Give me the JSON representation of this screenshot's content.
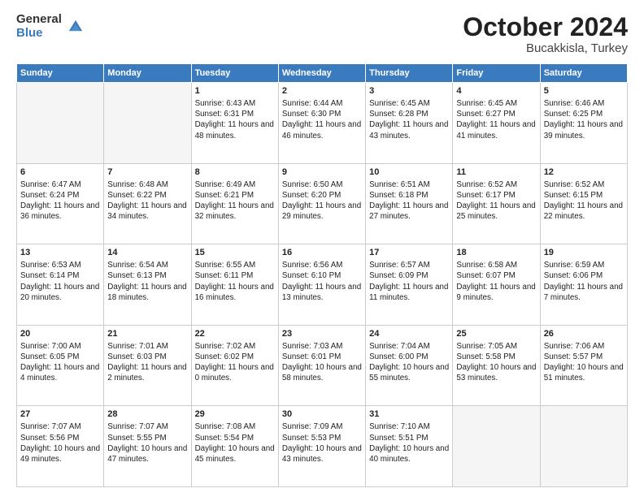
{
  "logo": {
    "general": "General",
    "blue": "Blue"
  },
  "header": {
    "month": "October 2024",
    "location": "Bucakkisla, Turkey"
  },
  "weekdays": [
    "Sunday",
    "Monday",
    "Tuesday",
    "Wednesday",
    "Thursday",
    "Friday",
    "Saturday"
  ],
  "weeks": [
    [
      {
        "day": "",
        "info": ""
      },
      {
        "day": "",
        "info": ""
      },
      {
        "day": "1",
        "info": "Sunrise: 6:43 AM\nSunset: 6:31 PM\nDaylight: 11 hours and 48 minutes."
      },
      {
        "day": "2",
        "info": "Sunrise: 6:44 AM\nSunset: 6:30 PM\nDaylight: 11 hours and 46 minutes."
      },
      {
        "day": "3",
        "info": "Sunrise: 6:45 AM\nSunset: 6:28 PM\nDaylight: 11 hours and 43 minutes."
      },
      {
        "day": "4",
        "info": "Sunrise: 6:45 AM\nSunset: 6:27 PM\nDaylight: 11 hours and 41 minutes."
      },
      {
        "day": "5",
        "info": "Sunrise: 6:46 AM\nSunset: 6:25 PM\nDaylight: 11 hours and 39 minutes."
      }
    ],
    [
      {
        "day": "6",
        "info": "Sunrise: 6:47 AM\nSunset: 6:24 PM\nDaylight: 11 hours and 36 minutes."
      },
      {
        "day": "7",
        "info": "Sunrise: 6:48 AM\nSunset: 6:22 PM\nDaylight: 11 hours and 34 minutes."
      },
      {
        "day": "8",
        "info": "Sunrise: 6:49 AM\nSunset: 6:21 PM\nDaylight: 11 hours and 32 minutes."
      },
      {
        "day": "9",
        "info": "Sunrise: 6:50 AM\nSunset: 6:20 PM\nDaylight: 11 hours and 29 minutes."
      },
      {
        "day": "10",
        "info": "Sunrise: 6:51 AM\nSunset: 6:18 PM\nDaylight: 11 hours and 27 minutes."
      },
      {
        "day": "11",
        "info": "Sunrise: 6:52 AM\nSunset: 6:17 PM\nDaylight: 11 hours and 25 minutes."
      },
      {
        "day": "12",
        "info": "Sunrise: 6:52 AM\nSunset: 6:15 PM\nDaylight: 11 hours and 22 minutes."
      }
    ],
    [
      {
        "day": "13",
        "info": "Sunrise: 6:53 AM\nSunset: 6:14 PM\nDaylight: 11 hours and 20 minutes."
      },
      {
        "day": "14",
        "info": "Sunrise: 6:54 AM\nSunset: 6:13 PM\nDaylight: 11 hours and 18 minutes."
      },
      {
        "day": "15",
        "info": "Sunrise: 6:55 AM\nSunset: 6:11 PM\nDaylight: 11 hours and 16 minutes."
      },
      {
        "day": "16",
        "info": "Sunrise: 6:56 AM\nSunset: 6:10 PM\nDaylight: 11 hours and 13 minutes."
      },
      {
        "day": "17",
        "info": "Sunrise: 6:57 AM\nSunset: 6:09 PM\nDaylight: 11 hours and 11 minutes."
      },
      {
        "day": "18",
        "info": "Sunrise: 6:58 AM\nSunset: 6:07 PM\nDaylight: 11 hours and 9 minutes."
      },
      {
        "day": "19",
        "info": "Sunrise: 6:59 AM\nSunset: 6:06 PM\nDaylight: 11 hours and 7 minutes."
      }
    ],
    [
      {
        "day": "20",
        "info": "Sunrise: 7:00 AM\nSunset: 6:05 PM\nDaylight: 11 hours and 4 minutes."
      },
      {
        "day": "21",
        "info": "Sunrise: 7:01 AM\nSunset: 6:03 PM\nDaylight: 11 hours and 2 minutes."
      },
      {
        "day": "22",
        "info": "Sunrise: 7:02 AM\nSunset: 6:02 PM\nDaylight: 11 hours and 0 minutes."
      },
      {
        "day": "23",
        "info": "Sunrise: 7:03 AM\nSunset: 6:01 PM\nDaylight: 10 hours and 58 minutes."
      },
      {
        "day": "24",
        "info": "Sunrise: 7:04 AM\nSunset: 6:00 PM\nDaylight: 10 hours and 55 minutes."
      },
      {
        "day": "25",
        "info": "Sunrise: 7:05 AM\nSunset: 5:58 PM\nDaylight: 10 hours and 53 minutes."
      },
      {
        "day": "26",
        "info": "Sunrise: 7:06 AM\nSunset: 5:57 PM\nDaylight: 10 hours and 51 minutes."
      }
    ],
    [
      {
        "day": "27",
        "info": "Sunrise: 7:07 AM\nSunset: 5:56 PM\nDaylight: 10 hours and 49 minutes."
      },
      {
        "day": "28",
        "info": "Sunrise: 7:07 AM\nSunset: 5:55 PM\nDaylight: 10 hours and 47 minutes."
      },
      {
        "day": "29",
        "info": "Sunrise: 7:08 AM\nSunset: 5:54 PM\nDaylight: 10 hours and 45 minutes."
      },
      {
        "day": "30",
        "info": "Sunrise: 7:09 AM\nSunset: 5:53 PM\nDaylight: 10 hours and 43 minutes."
      },
      {
        "day": "31",
        "info": "Sunrise: 7:10 AM\nSunset: 5:51 PM\nDaylight: 10 hours and 40 minutes."
      },
      {
        "day": "",
        "info": ""
      },
      {
        "day": "",
        "info": ""
      }
    ]
  ]
}
